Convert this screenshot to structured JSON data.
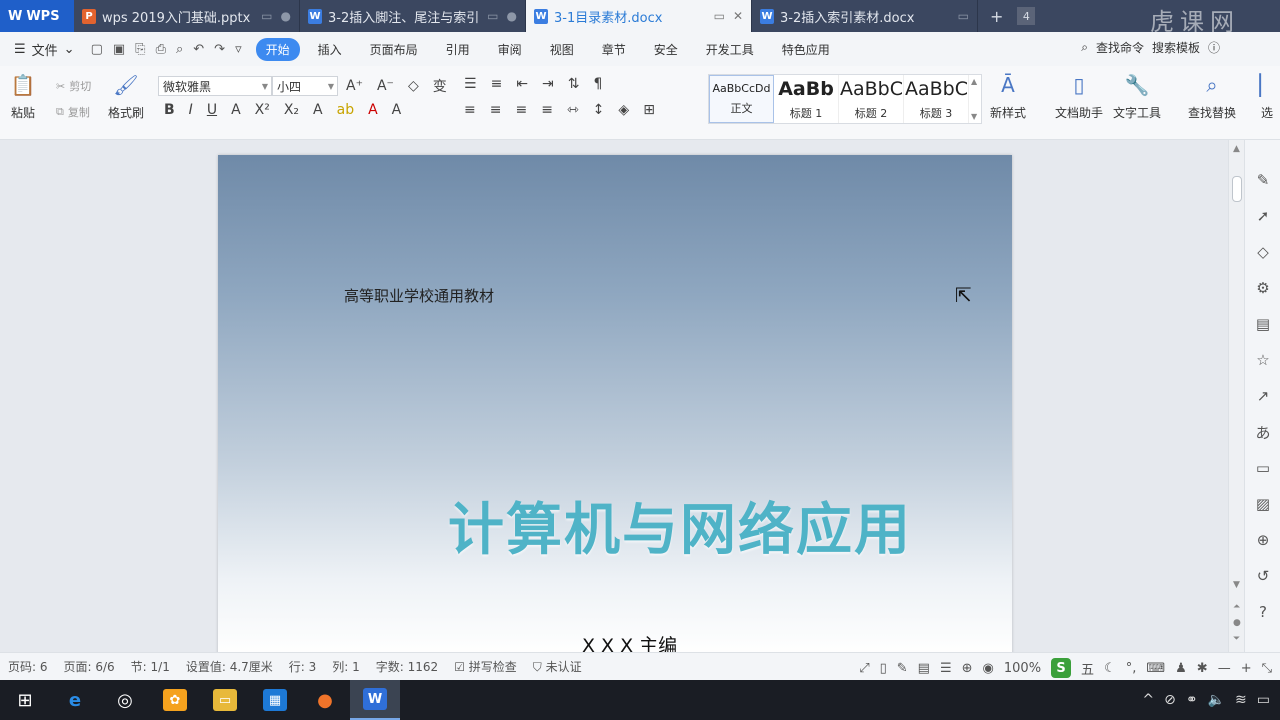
{
  "app": {
    "name": "WPS"
  },
  "tabs": [
    {
      "label": "wps 2019入门基础.pptx",
      "type": "P",
      "active": false
    },
    {
      "label": "3-2插入脚注、尾注与索引",
      "type": "W",
      "active": false
    },
    {
      "label": "3-1目录素材.docx",
      "type": "W",
      "active": true
    },
    {
      "label": "3-2插入索引素材.docx",
      "type": "W",
      "active": false
    }
  ],
  "titlebar": {
    "count": "4",
    "watermark": "虎课网"
  },
  "menu": {
    "file_label": "文件",
    "items": [
      "开始",
      "插入",
      "页面布局",
      "引用",
      "审阅",
      "视图",
      "章节",
      "安全",
      "开发工具",
      "特色应用"
    ],
    "search_cmd": "查找命令",
    "search_template": "搜索模板"
  },
  "ribbon": {
    "paste": "粘贴",
    "cut": "剪切",
    "copy": "复制",
    "format_painter": "格式刷",
    "font_name": "微软雅黑",
    "font_size": "小四",
    "styles": [
      {
        "sample": "AaBbCcDd",
        "label": "正文"
      },
      {
        "sample": "AaBb",
        "label": "标题 1"
      },
      {
        "sample": "AaBbC",
        "label": "标题 2"
      },
      {
        "sample": "AaBbC",
        "label": "标题 3"
      }
    ],
    "new_style": "新样式",
    "doc_helper": "文档助手",
    "text_tools": "文字工具",
    "find_replace": "查找替换",
    "select": "选"
  },
  "document": {
    "subtitle": "高等职业学校通用教材",
    "title": "计算机与网络应用",
    "editor": "X X X 主编"
  },
  "status": {
    "page_code": "页码: 6",
    "pages": "页面: 6/6",
    "section": "节: 1/1",
    "setting": "设置值: 4.7厘米",
    "row": "行: 3",
    "col": "列: 1",
    "words": "字数: 1162",
    "spell": "拼写检查",
    "cert": "未认证",
    "zoom": "100%"
  }
}
